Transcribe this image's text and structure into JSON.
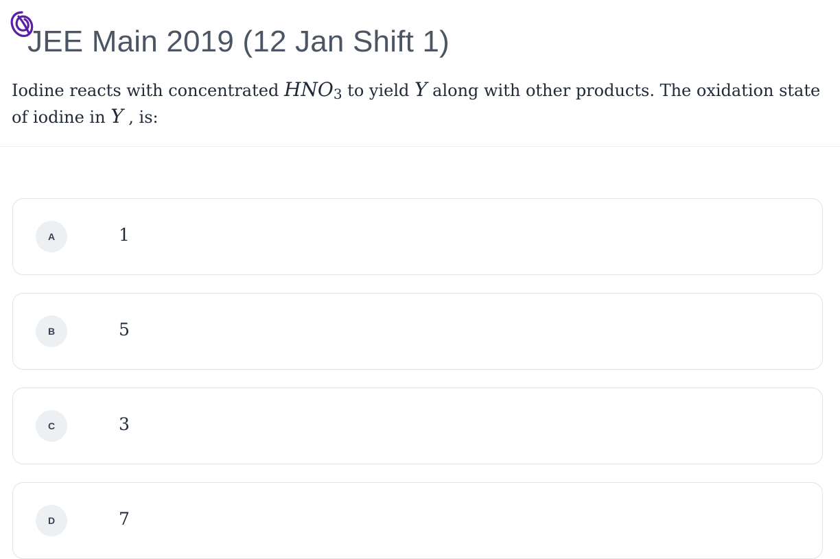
{
  "header": {
    "title": "JEE Main 2019 (12 Jan Shift 1)"
  },
  "question": {
    "part1": "Iodine reacts with concentrated ",
    "formula_main": "HNO",
    "formula_sub": "3",
    "part2": " to yield ",
    "var1": "Y",
    "part3": " along with other products. The oxidation state of iodine in ",
    "var2": "Y",
    "part4": " , is:"
  },
  "options": [
    {
      "letter": "A",
      "value": "1"
    },
    {
      "letter": "B",
      "value": "5"
    },
    {
      "letter": "C",
      "value": "3"
    },
    {
      "letter": "D",
      "value": "7"
    }
  ],
  "colors": {
    "annotation": "#5b1fa6",
    "title": "#4b5563",
    "text": "#1f2937",
    "badge_bg": "#edf0f3",
    "border": "#dfe3e8"
  },
  "icons": {
    "annotation": "handwritten-annotation-mark"
  }
}
